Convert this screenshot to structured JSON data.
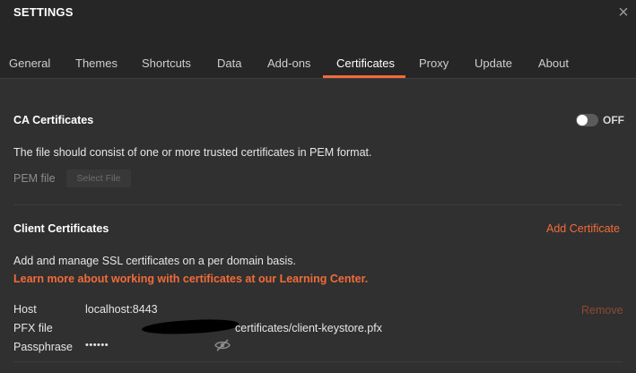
{
  "window": {
    "title": "SETTINGS",
    "close_symbol": "×"
  },
  "tabs": [
    {
      "label": "General"
    },
    {
      "label": "Themes"
    },
    {
      "label": "Shortcuts"
    },
    {
      "label": "Data"
    },
    {
      "label": "Add-ons"
    },
    {
      "label": "Certificates",
      "active": true
    },
    {
      "label": "Proxy"
    },
    {
      "label": "Update"
    },
    {
      "label": "About"
    }
  ],
  "ca_certificates": {
    "title": "CA Certificates",
    "toggle_state": "OFF",
    "description": "The file should consist of one or more trusted certificates in PEM format.",
    "pem_label": "PEM file",
    "select_file_label": "Select File"
  },
  "client_certificates": {
    "title": "Client Certificates",
    "add_label": "Add Certificate",
    "description": "Add and manage SSL certificates on a per domain basis.",
    "learn_more": "Learn more about working with certificates at our Learning Center.",
    "entry": {
      "host_label": "Host",
      "host_value": "localhost:8443",
      "remove_label": "Remove",
      "pfx_label": "PFX file",
      "pfx_value": "certificates/client-keystore.pfx",
      "passphrase_label": "Passphrase",
      "passphrase_value": "••••••"
    }
  },
  "colors": {
    "accent": "#f26b3a",
    "background": "#303030",
    "header": "#262626"
  },
  "icons": {
    "close": "close-icon",
    "visibility": "eye-slash-icon"
  }
}
